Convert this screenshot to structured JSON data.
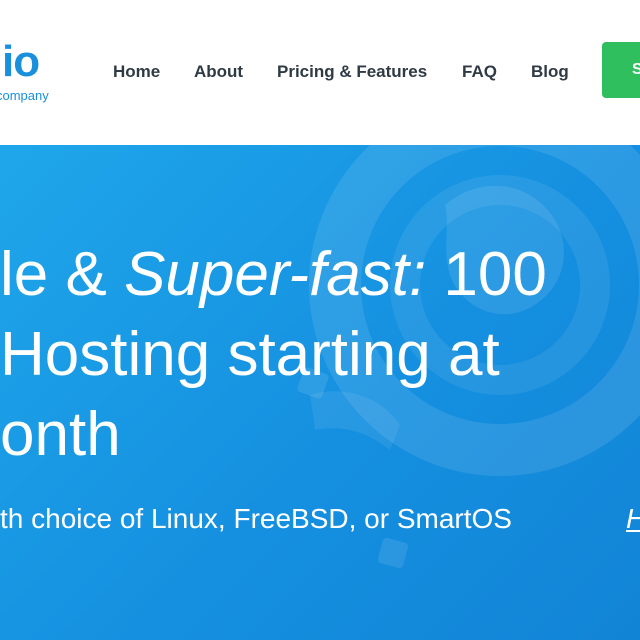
{
  "header": {
    "logo_text": "io",
    "logo_subtext": "company",
    "nav": [
      {
        "label": "Home"
      },
      {
        "label": "About"
      },
      {
        "label": "Pricing & Features"
      },
      {
        "label": "FAQ"
      },
      {
        "label": "Blog"
      }
    ],
    "cta_label": "S"
  },
  "hero": {
    "title_line1_part1": "le & ",
    "title_line1_emphasis": "Super-fast:",
    "title_line1_part2": " 100",
    "title_line2": " Hosting starting at",
    "title_line3": "onth",
    "subtitle": "th choice of Linux, FreeBSD, or SmartOS",
    "link_label": "H"
  },
  "colors": {
    "brand": "#1a8fdc",
    "nav_text": "#2f3a45",
    "cta": "#2fbf5f",
    "hero_bg": "#1a9be6"
  }
}
